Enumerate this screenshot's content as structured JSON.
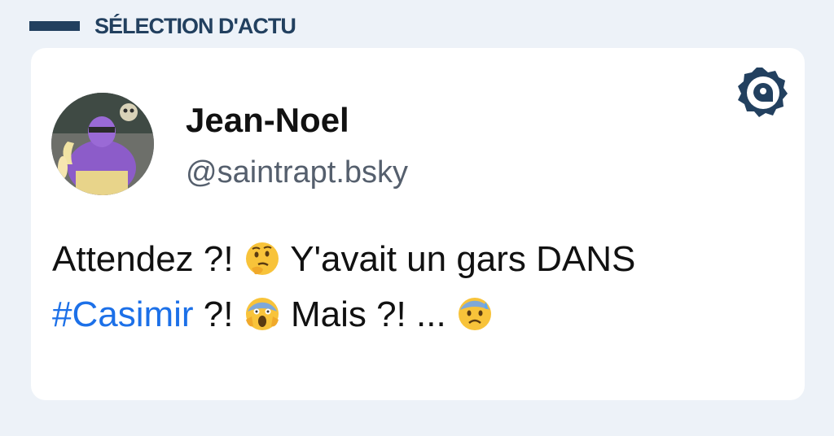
{
  "section": {
    "title": "SÉLECTION D'ACTU"
  },
  "author": {
    "name": "Jean-Noel",
    "handle": "@saintrapt.bsky"
  },
  "post": {
    "part1": "Attendez ?! ",
    "part2": " Y'avait un gars DANS",
    "hashtag": "#Casimir",
    "part3": " ?! ",
    "part4": " Mais ?! ... ",
    "emojis": [
      "thinking-face",
      "face-screaming-in-fear",
      "anxious-face-with-sweat"
    ]
  },
  "icons": {
    "brand": "brand-logo-icon"
  },
  "colors": {
    "background": "#edf2f8",
    "accent": "#22405f",
    "hashtag": "#1c70e8",
    "handle": "#555f6d"
  }
}
